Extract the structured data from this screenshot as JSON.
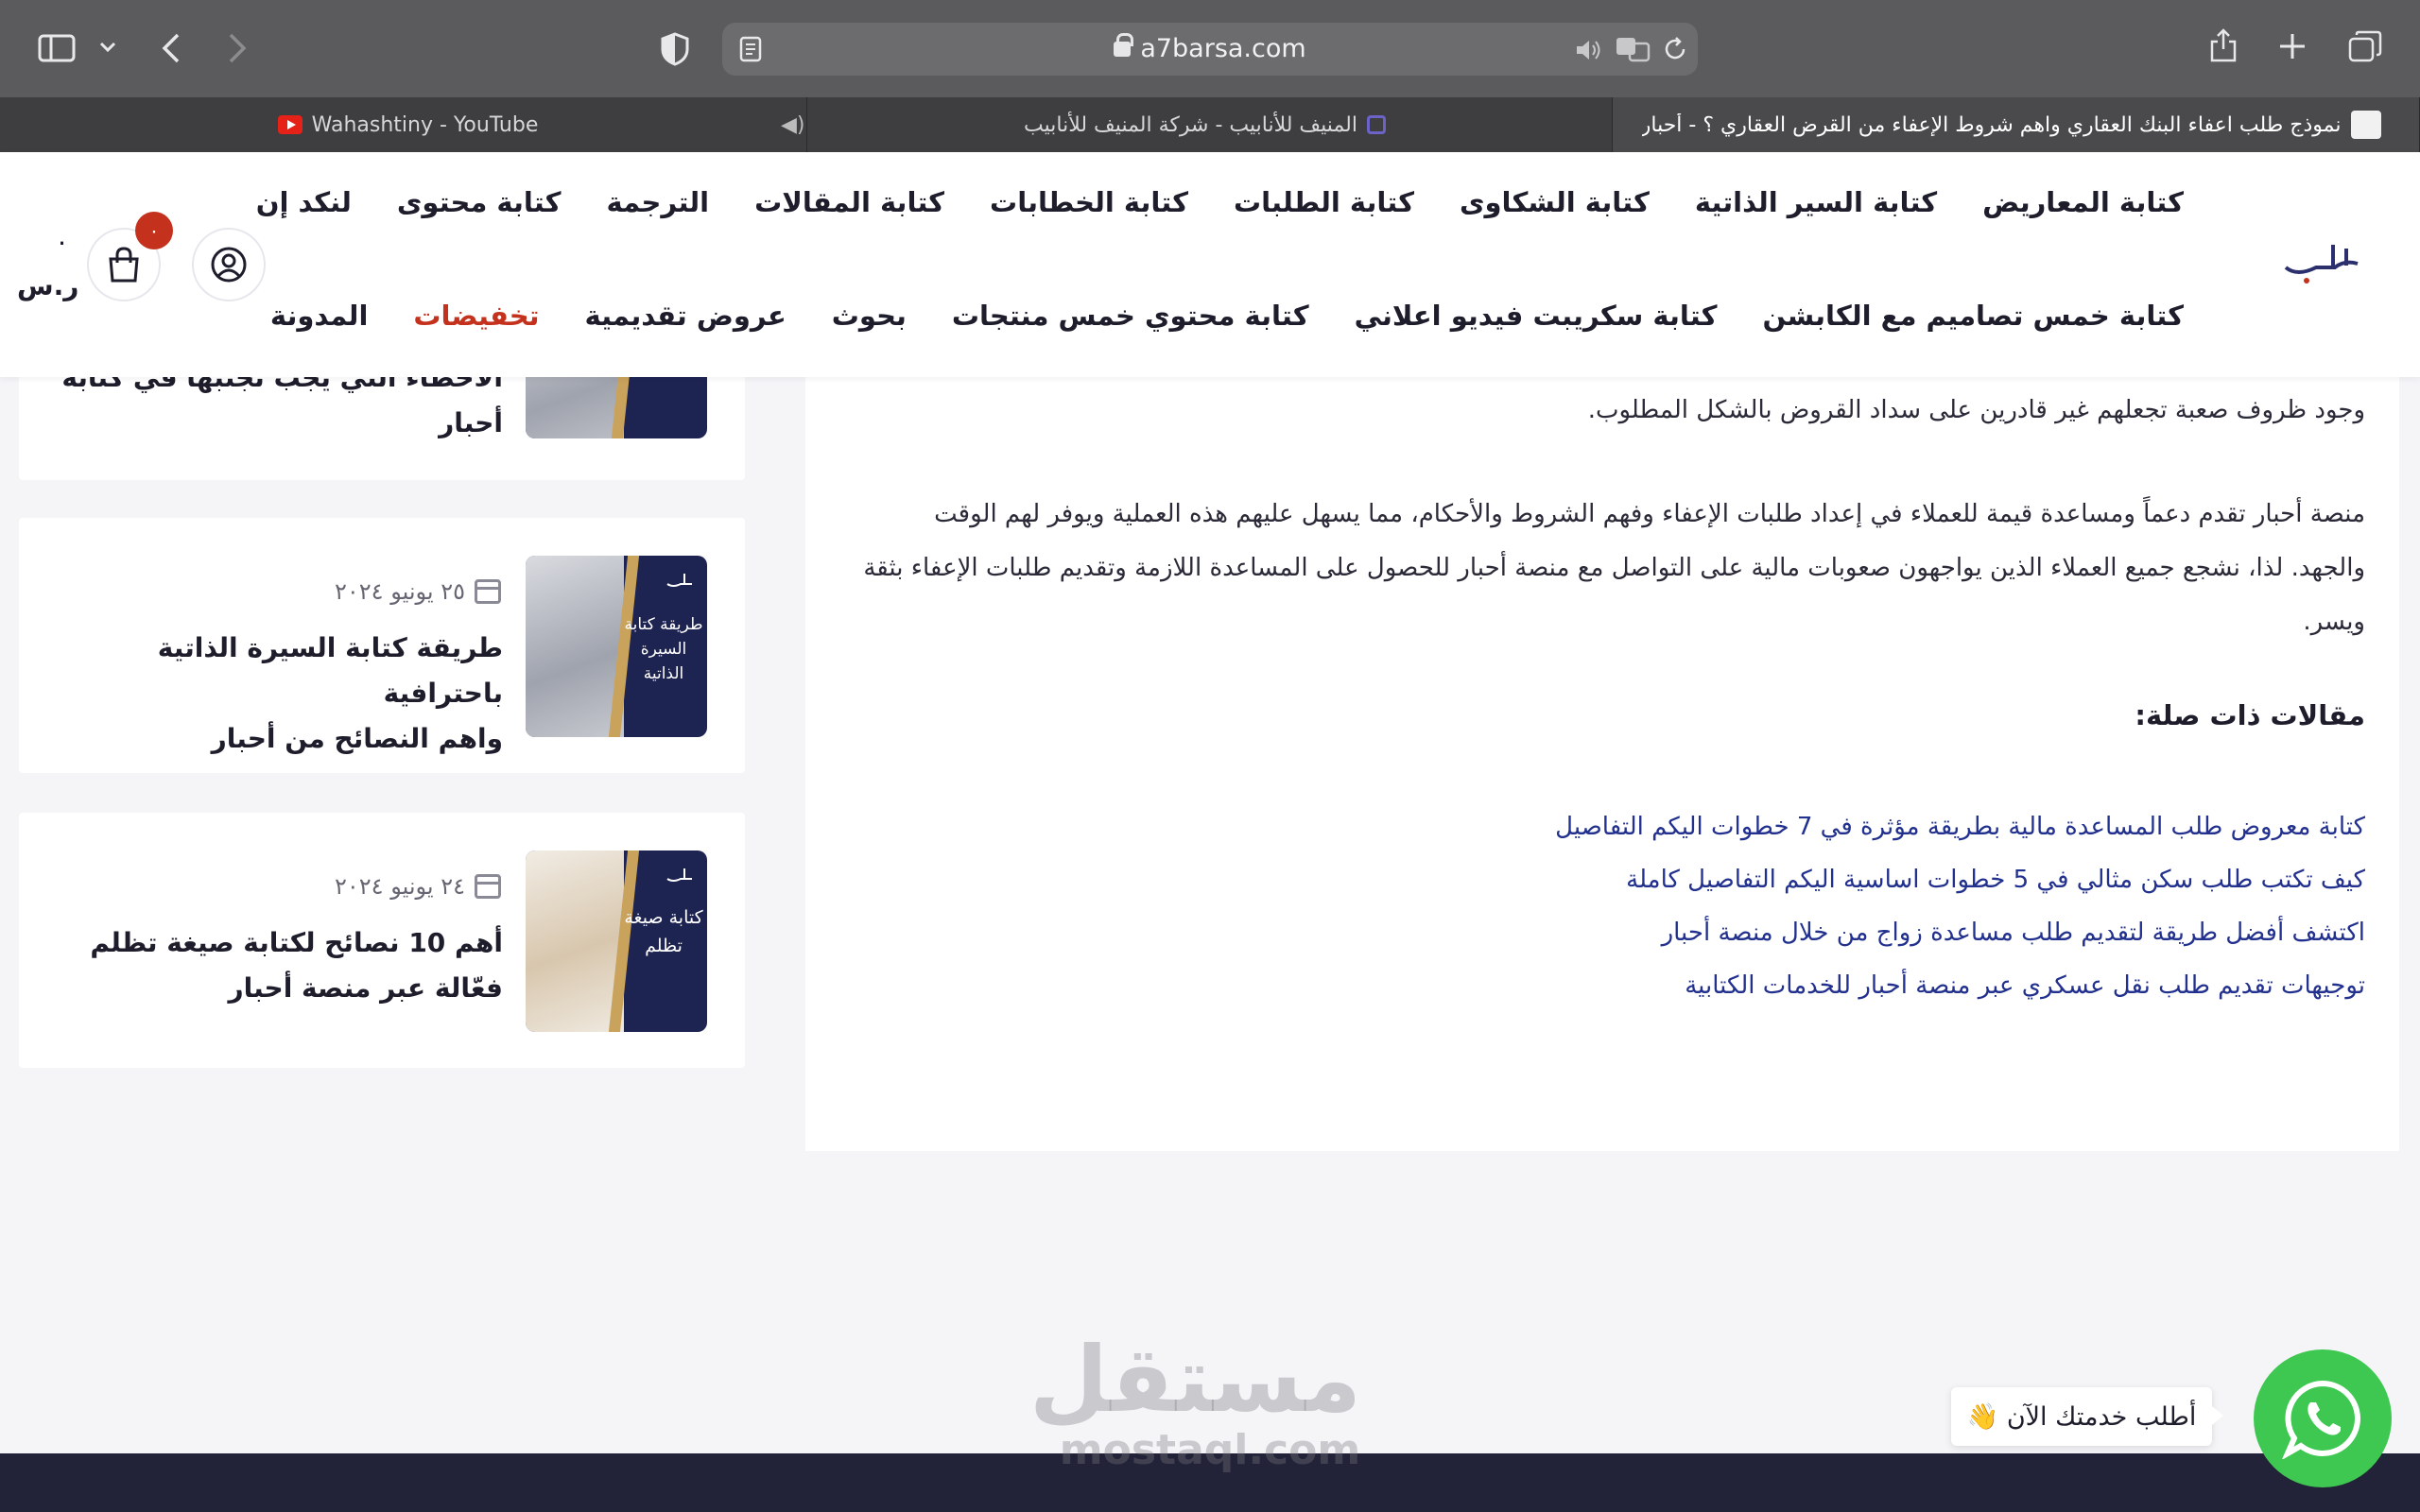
{
  "browser": {
    "url": "a7barsa.com",
    "tabs": [
      {
        "title": "Wahashtiny - YouTube",
        "icon": "youtube-icon"
      },
      {
        "title": "المنيف للأنابيب - شركة المنيف للأنابيب",
        "icon": "pipe-icon"
      },
      {
        "title": "نموذج طلب اعفاء البنك العقاري واهم شروط الإعفاء من القرض العقاري ؟ - أحبار لـ..",
        "icon": "ahbar-icon"
      }
    ]
  },
  "header": {
    "nav_row1": [
      "كتابة المعاريض",
      "كتابة السير الذاتية",
      "كتابة الشكاوى",
      "كتابة الطلبات",
      "كتابة الخطابات",
      "كتابة المقالات",
      "الترجمة",
      "كتابة محتوى",
      "لنكد إن"
    ],
    "nav_row2": [
      "كتابة خمس تصاميم مع الكابشن",
      "كتابة سكريبت فيديو اعلاني",
      "كتابة محتوي خمس منتجات",
      "بحوث",
      "عروض تقديمية",
      "تخفيضات",
      "المدونة"
    ],
    "sale_color": "#c4321d",
    "cart_count": "٠",
    "price_value": "٠",
    "currency": "ر.س"
  },
  "article": {
    "paragraph1": "وجود ظروف صعبة تجعلهم غير قادرين على سداد القروض بالشكل المطلوب.",
    "paragraph2": "منصة أحبار تقدم دعماً ومساعدة قيمة للعملاء في إعداد طلبات الإعفاء وفهم الشروط والأحكام، مما يسهل عليهم هذه العملية ويوفر لهم الوقت والجهد. لذا، نشجع جميع العملاء الذين يواجهون صعوبات مالية على التواصل مع منصة أحبار للحصول على المساعدة اللازمة وتقديم طلبات الإعفاء بثقة ويسر.",
    "related_title": "مقالات ذات صلة:",
    "related_links": [
      "كتابة معروض طلب المساعدة مالية بطريقة مؤثرة في 7 خطوات اليكم التفاصيل",
      "كيف تكتب طلب سكن مثالي في 5 خطوات اساسية اليكم التفاصيل كاملة",
      "اكتشف أفضل طريقة لتقديم طلب مساعدة زواج من خلال منصة أحبار",
      "توجيهات تقديم طلب نقل عسكري عبر منصة أحبار للخدمات الكتابية"
    ],
    "link_color": "#22308e"
  },
  "sidebar": {
    "cards": [
      {
        "title_line1": "الأخطاء التي يجب تجنبها في كتابة",
        "title_line2": "أحبار",
        "date": "",
        "thumb_text": ""
      },
      {
        "title_line1": "طريقة كتابة السيرة الذاتية باحترافية",
        "title_line2": "واهم النصائح من أحبار",
        "date": "٢٥ يونيو ٢٠٢٤",
        "thumb_text": "طريقة كتابة السيرة الذاتية"
      },
      {
        "title_line1": "أهم 10 نصائح لكتابة صيغة تظلم",
        "title_line2": "فعّالة عبر منصة أحبار",
        "date": "٢٤ يونيو ٢٠٢٤",
        "thumb_text": "كتابة صيغة تظلم"
      }
    ]
  },
  "watermark": {
    "arabic": "مستقل",
    "latin": "mostaql.com"
  },
  "whatsapp": {
    "bubble_text": "أطلب خدمتك الآن 👋",
    "color": "#3ec852"
  }
}
